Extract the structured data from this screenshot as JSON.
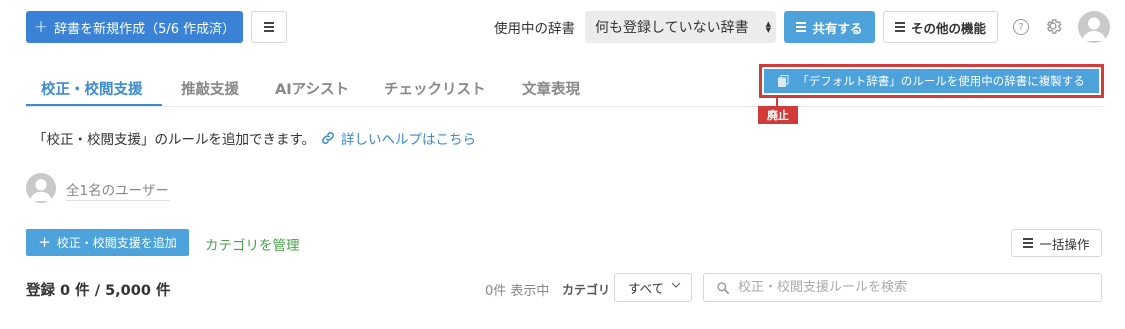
{
  "header": {
    "new_dict_button": "辞書を新規作成（5/6 作成済）",
    "dict_label": "使用中の辞書",
    "dict_select_value": "何も登録していない辞書",
    "share_button": "共有する",
    "other_button": "その他の機能",
    "help_icon": "question-circle-icon",
    "settings_icon": "gear-icon"
  },
  "tabs": [
    {
      "label": "校正・校閲支援",
      "active": true
    },
    {
      "label": "推敲支援",
      "active": false
    },
    {
      "label": "AIアシスト",
      "active": false
    },
    {
      "label": "チェックリスト",
      "active": false
    },
    {
      "label": "文章表現",
      "active": false
    }
  ],
  "copy_rules_button": "「デフォルト辞書」のルールを使用中の辞書に複製する",
  "deprecated_tag": "廃止",
  "description": "「校正・校閲支援」のルールを追加できます。",
  "help_link": "詳しいヘルプはこちら",
  "users": {
    "label": "全1名のユーザー"
  },
  "actions": {
    "add_rule_button": "校正・校閲支援を追加",
    "manage_category_link": "カテゴリを管理",
    "bulk_button": "一括操作"
  },
  "list": {
    "total_count": "登録 0 件 / 5,000 件",
    "shown_count": "0件 表示中",
    "category_label": "カテゴリ",
    "category_value": "すべて",
    "search_placeholder": "校正・校閲支援ルールを検索"
  },
  "colors": {
    "primary": "#3a82d6",
    "accent": "#4da2db",
    "highlight_red": "#d33a3a",
    "link_green": "#4aa04a"
  }
}
